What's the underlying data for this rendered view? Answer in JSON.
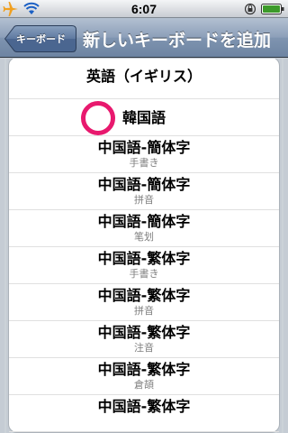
{
  "status_bar": {
    "time": "6:07"
  },
  "nav": {
    "back_label": "キーボード",
    "title": "新しいキーボードを追加"
  },
  "keyboards": [
    {
      "name": "英語（イギリス）",
      "sub": ""
    },
    {
      "name": "韓国語",
      "sub": ""
    },
    {
      "name": "中国語-簡体字",
      "sub": "手書き"
    },
    {
      "name": "中国語-簡体字",
      "sub": "拼音"
    },
    {
      "name": "中国語-簡体字",
      "sub": "笔划"
    },
    {
      "name": "中国語-繁体字",
      "sub": "手書き"
    },
    {
      "name": "中国語-繁体字",
      "sub": "拼音"
    },
    {
      "name": "中国語-繁体字",
      "sub": "注音"
    },
    {
      "name": "中国語-繁体字",
      "sub": "倉頡"
    },
    {
      "name": "中国語-繁体字",
      "sub": ""
    }
  ],
  "colors": {
    "highlight_circle": "#e8196e",
    "nav_bar": "#7f94b0"
  },
  "icons": {
    "airplane": "airplane-icon",
    "wifi": "wifi-icon",
    "lock": "rotation-lock-icon",
    "battery": "battery-icon"
  }
}
